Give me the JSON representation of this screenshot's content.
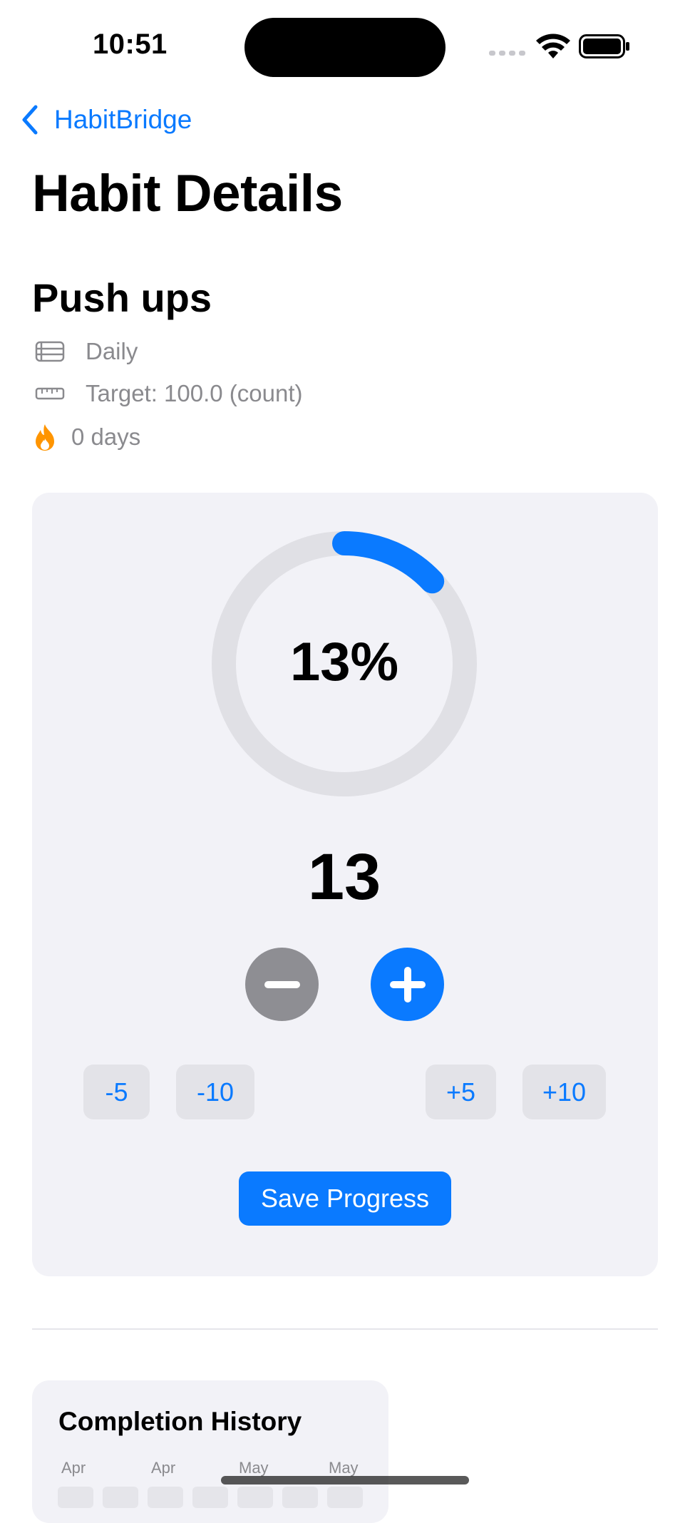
{
  "status_bar": {
    "time": "10:51"
  },
  "nav": {
    "back_label": "HabitBridge",
    "title": "Habit Details"
  },
  "habit": {
    "name": "Push ups",
    "frequency": "Daily",
    "target": "Target: 100.0 (count)",
    "streak": "0 days"
  },
  "progress": {
    "percent_text": "13%",
    "fraction": 0.13,
    "count": "13",
    "accent_color": "#0A7AFF",
    "track_color": "#E0E0E5"
  },
  "steps": {
    "minus5": "-5",
    "minus10": "-10",
    "plus5": "+5",
    "plus10": "+10"
  },
  "save_label": "Save Progress",
  "history": {
    "title": "Completion History",
    "months": [
      "Apr",
      "Apr",
      "May",
      "May"
    ]
  },
  "icons": {
    "back": "chevron-left-icon",
    "frequency": "calendar-list-icon",
    "target": "ruler-icon",
    "streak": "flame-icon",
    "decrement": "minus-circle-icon",
    "increment": "plus-circle-icon"
  }
}
